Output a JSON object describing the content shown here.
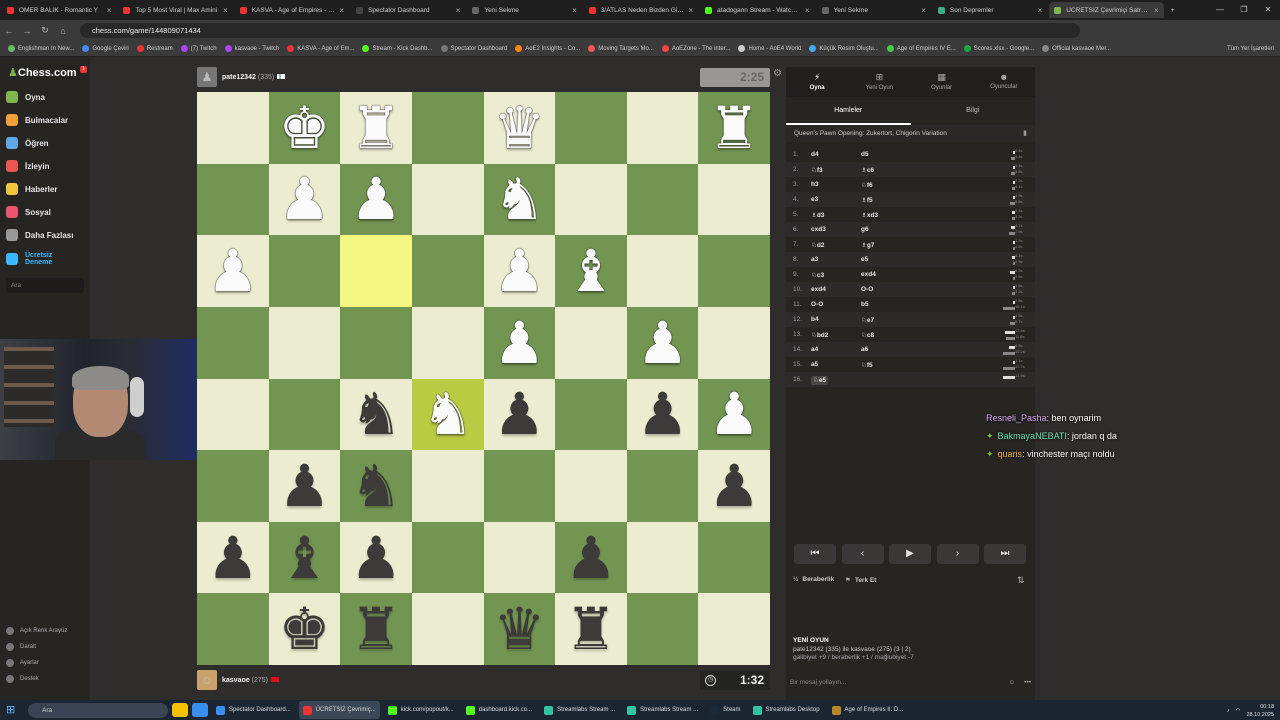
{
  "browser": {
    "tabs": [
      {
        "label": "OMER BALIK - Romantic Y",
        "color": "#e33"
      },
      {
        "label": "Top 5 Most Viral | Max Amini",
        "color": "#e33"
      },
      {
        "label": "KASVA - Age of Empires - You",
        "color": "#e33"
      },
      {
        "label": "Spectator Dashboard",
        "color": "#444"
      },
      {
        "label": "Yeni Sekme",
        "color": "#666"
      },
      {
        "label": "3/ATLAS Neden Bizden Gizle",
        "color": "#e33"
      },
      {
        "label": "atadogann Stream - Watch Li",
        "color": "#53fc18"
      },
      {
        "label": "Yeni Sekme",
        "color": "#666"
      },
      {
        "label": "Son Depremler",
        "color": "#4a8"
      },
      {
        "label": "ÜCRETSİZ Çevrimiçi Satranç O",
        "color": "#81b64c",
        "active": true
      }
    ],
    "url": "chess.com/game/144809071434",
    "bookmarks": [
      "Englishman In New...",
      "Google Çeviri",
      "Restream",
      "(7) Twitch",
      "kasvaoe - Twitch",
      "KASVA - Age of Em...",
      "Stream - Kick Dashb...",
      "Spectator Dashboard",
      "AoE2 Insights - Co...",
      "Moving Targets Mo...",
      "AoEZone - The inter...",
      "Home - AoE4 World",
      "Küçük Resim Oluştu...",
      "Age of Empires IV E...",
      "Scores.xlsx - Google...",
      "Official kasvaoe Mer..."
    ],
    "bookmarks_right": "Tüm Yer İşaretleri"
  },
  "sidebar": {
    "logo": "Chess.com",
    "notif": "1",
    "items": [
      {
        "label": "Oyna",
        "color": "#81b64c"
      },
      {
        "label": "Bulmacalar",
        "color": "#f29e3b"
      },
      {
        "label": "Öğren",
        "color": "#5ea8e8"
      },
      {
        "label": "İzleyin",
        "color": "#e8584e"
      },
      {
        "label": "Haberler",
        "color": "#f0c43c"
      },
      {
        "label": "Sosyal",
        "color": "#e8566f"
      },
      {
        "label": "Daha Fazlası",
        "color": "#999"
      },
      {
        "label": "Ücretsiz Deneme",
        "color": "#3db7ff"
      }
    ],
    "search_placeholder": "Ara",
    "bottom": [
      "Açık Renk Arayüz",
      "Daralt",
      "Ayarlar",
      "Destek"
    ]
  },
  "game": {
    "top_player": {
      "name": "pate12342",
      "rating": "(335)"
    },
    "top_clock": "2:25",
    "bottom_player": {
      "name": "kasvaoe",
      "rating": "(275)"
    },
    "bottom_clock": "1:32",
    "board_rows": [
      [
        "",
        "wK",
        "wR",
        "",
        "wQ",
        "",
        "",
        "wR"
      ],
      [
        "",
        "wP",
        "wP",
        "",
        "wN",
        "",
        "",
        ""
      ],
      [
        "wP",
        "",
        "",
        "",
        "wP",
        "wB",
        "",
        ""
      ],
      [
        "",
        "",
        "",
        "",
        "wP",
        "",
        "wP",
        ""
      ],
      [
        "",
        "",
        "bN",
        "wN",
        "bP",
        "",
        "bP",
        "wP"
      ],
      [
        "",
        "bP",
        "bN",
        "",
        "",
        "",
        "",
        "bP"
      ],
      [
        "bP",
        "bB",
        "bP",
        "",
        "",
        "bP",
        "",
        ""
      ],
      [
        "",
        "bK",
        "bR",
        "",
        "bQ",
        "bR",
        "",
        ""
      ]
    ],
    "highlights": [
      [
        2,
        2
      ],
      [
        4,
        3
      ]
    ]
  },
  "panel": {
    "tabs": [
      {
        "label": "Oyna",
        "icon": "bolt-icon",
        "active": true
      },
      {
        "label": "Yeni Oyun",
        "icon": "plus-icon"
      },
      {
        "label": "Oyunlar",
        "icon": "board-icon"
      },
      {
        "label": "Oyuncular",
        "icon": "players-icon"
      }
    ],
    "subtabs": [
      "Hamleler",
      "Bilgi"
    ],
    "opening": "Queen's Pawn Opening: Zukertort, Chigorin Variation",
    "moves": [
      {
        "n": "1.",
        "w": "d4",
        "b": "d5",
        "tw": "0.4s",
        "tb": "5.4s"
      },
      {
        "n": "2.",
        "w": "♘f3",
        "b": "♗c6",
        "tw": "1.4s",
        "tb": "5.6s"
      },
      {
        "n": "3.",
        "w": "h3",
        "b": "♘f6",
        "tw": "2.2s",
        "tb": "4.1s"
      },
      {
        "n": "4.",
        "w": "e3",
        "b": "♗f5",
        "tw": "1.9s",
        "tb": "5.8s"
      },
      {
        "n": "5.",
        "w": "♗d3",
        "b": "♗xd3",
        "tw": "3.4s",
        "tb": "3.3s"
      },
      {
        "n": "6.",
        "w": "cxd3",
        "b": "g6",
        "tw": "4.7s",
        "tb": "7.9s"
      },
      {
        "n": "7.",
        "w": "♘d2",
        "b": "♗g7",
        "tw": "1.3s",
        "tb": "1.5s"
      },
      {
        "n": "8.",
        "w": "a3",
        "b": "e5",
        "tw": "4.1s",
        "tb": "0.9s"
      },
      {
        "n": "9.",
        "w": "♘c3",
        "b": "exd4",
        "tw": "6.3s",
        "tb": "2.6s"
      },
      {
        "n": "10.",
        "w": "exd4",
        "b": "O-O",
        "tw": "1.5s",
        "tb": "3.2s"
      },
      {
        "n": "11.",
        "w": "O-O",
        "b": "b5",
        "tw": "2.8s",
        "tb": "15.1s"
      },
      {
        "n": "12.",
        "w": "b4",
        "b": "♘e7",
        "tw": "1.5s",
        "tb": "5.7s"
      },
      {
        "n": "13.",
        "w": "♘bd2",
        "b": "♘c8",
        "tw": "12.4s",
        "tb": "11.6s"
      },
      {
        "n": "14.",
        "w": "a4",
        "b": "a6",
        "tw": "6.9s",
        "tb": "15.2s"
      },
      {
        "n": "15.",
        "w": "a5",
        "b": "♘f5",
        "tw": "1.1s",
        "tb": "17.7s"
      },
      {
        "n": "16.",
        "w": "♘e5",
        "b": "",
        "tw": "14.6s",
        "tb": "",
        "current": true
      }
    ],
    "controls": [
      "⏮",
      "‹",
      "▶",
      "›",
      "⏭"
    ],
    "actions": {
      "draw": "Beraberlik",
      "resign": "Terk Et"
    },
    "new_game": {
      "title": "YENİ OYUN",
      "players": "pate12342 (335) ile kasvaoe (275) (3 | 2)",
      "record": "galibiyet +9 / beraberlik +1 / mağlubiyet -7"
    },
    "chat_placeholder": "Bir mesaj yollayın..."
  },
  "chat_overlay": [
    {
      "user": "Resneli_Pasha",
      "msg": ": ben oynarim"
    },
    {
      "user": "BakmayaNEBATI",
      "msg": ": jordan q da"
    },
    {
      "user": "quaris",
      "msg": ": vinchester maçı noldu"
    }
  ],
  "taskbar": {
    "search": "Ara",
    "apps": [
      "Spectator Dashboard...",
      "ÜCRETSİZ Çevrimiç...",
      "kick.com/popout/k...",
      "dashboard.kick.co...",
      "Streamlabs Stream ...",
      "Streamlabs Stream ...",
      "Steam",
      "Streamlabs Desktop",
      "Age of Empires II: D..."
    ],
    "time": "00:18",
    "date": "28.10.2025"
  }
}
